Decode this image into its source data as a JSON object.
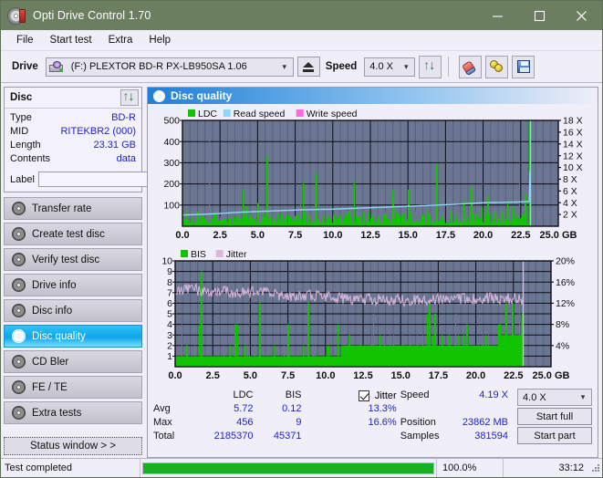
{
  "window": {
    "title": "Opti Drive Control 1.70",
    "icon": "disc-icon",
    "minimize": "minimize-icon",
    "maximize": "maximize-icon",
    "close": "close-icon"
  },
  "menubar": {
    "items": [
      {
        "label": "File",
        "accel": "F"
      },
      {
        "label": "Start test",
        "accel": "S"
      },
      {
        "label": "Extra",
        "accel": "x"
      },
      {
        "label": "Help",
        "accel": "H"
      }
    ]
  },
  "toolbar": {
    "drive_label": "Drive",
    "drive_value": "(F:)   PLEXTOR BD-R  PX-LB950SA 1.06",
    "drive_icon": "drive-icon",
    "eject_label": "eject-icon",
    "speed_label": "Speed",
    "speed_value": "4.0 X",
    "refresh_icon": "refresh-icon",
    "erase_icon": "eraser-icon",
    "key_icon": "key-icon",
    "save_icon": "floppy-save-icon"
  },
  "sidebar": {
    "disc_panel": {
      "title": "Disc",
      "refresh_icon": "refresh-icon",
      "rows": [
        {
          "key": "Type",
          "value": "BD-R"
        },
        {
          "key": "MID",
          "value": "RITEKBR2 (000)"
        },
        {
          "key": "Length",
          "value": "23.31 GB"
        },
        {
          "key": "Contents",
          "value": "data"
        }
      ],
      "label_key": "Label",
      "label_value": "",
      "label_placeholder": "",
      "label_button_icon": "cd-icon"
    },
    "nav": [
      {
        "label": "Transfer rate",
        "icon": "disc-icon",
        "active": false
      },
      {
        "label": "Create test disc",
        "icon": "disc-icon",
        "active": false
      },
      {
        "label": "Verify test disc",
        "icon": "disc-icon",
        "active": false
      },
      {
        "label": "Drive info",
        "icon": "disc-icon",
        "active": false
      },
      {
        "label": "Disc info",
        "icon": "disc-icon",
        "active": false
      },
      {
        "label": "Disc quality",
        "icon": "disc-icon",
        "active": true
      },
      {
        "label": "CD Bler",
        "icon": "disc-icon",
        "active": false
      },
      {
        "label": "FE / TE",
        "icon": "disc-icon",
        "active": false
      },
      {
        "label": "Extra tests",
        "icon": "disc-icon",
        "active": false
      }
    ],
    "status_window_button": "Status window > >"
  },
  "content": {
    "header": "Disc quality",
    "header_icon": "disc-icon"
  },
  "stats": {
    "col_headers": {
      "ldc": "LDC",
      "bis": "BIS",
      "jitter": "Jitter"
    },
    "jitter_checked": true,
    "rows": [
      {
        "key": "Avg",
        "ldc": "5.72",
        "bis": "0.12",
        "jitter": "13.3%"
      },
      {
        "key": "Max",
        "ldc": "456",
        "bis": "9",
        "jitter": "16.6%"
      },
      {
        "key": "Total",
        "ldc": "2185370",
        "bis": "45371",
        "jitter": ""
      }
    ],
    "right": [
      {
        "key": "Speed",
        "value": "4.19 X"
      },
      {
        "key": "Position",
        "value": "23862 MB"
      },
      {
        "key": "Samples",
        "value": "381594"
      }
    ],
    "speed_select": "4.0 X",
    "start_full": "Start full",
    "start_part": "Start part"
  },
  "statusbar": {
    "text": "Test completed",
    "progress_percent": 100.0,
    "percent_label": "100.0%",
    "elapsed": "33:12"
  },
  "colors": {
    "titlebar": "#6b7f60",
    "accent_blue": "#1f7fd8",
    "chart_bg": "#6b7693",
    "ldc_green": "#12c400",
    "read_speed": "#8fd8f5",
    "write_speed": "#ff66dd",
    "jitter_pink": "#d9b6da",
    "value_text": "#2222cc",
    "progress_green": "#16b020"
  },
  "chart_data": [
    {
      "type": "line",
      "title": "Disc quality - LDC",
      "xlabel": "GB",
      "ylabel": "LDC",
      "xlim": [
        0,
        25
      ],
      "ylim": [
        0,
        500
      ],
      "y2lim": [
        0,
        18
      ],
      "y2label": "X",
      "grid": true,
      "legend_position": "top-left",
      "xticks": [
        "0.0",
        "2.5",
        "5.0",
        "7.5",
        "10.0",
        "12.5",
        "15.0",
        "17.5",
        "20.0",
        "22.5",
        "25.0 GB"
      ],
      "yticks": [
        "100",
        "200",
        "300",
        "400",
        "500"
      ],
      "y2ticks": [
        "2 X",
        "4 X",
        "6 X",
        "8 X",
        "10 X",
        "12 X",
        "14 X",
        "16 X",
        "18 X"
      ],
      "series": [
        {
          "name": "LDC",
          "color": "#12c400",
          "type": "bar",
          "note": "dense green spike field, baseline ~20-60, peaks at 1.75GB=456, 5.6GB=333, 8.9GB=250, 11.4GB=208, 16.9GB=295, 22.4GB=215, 23.1GB=500+",
          "x": [
            0.0,
            0.3,
            0.6,
            0.9,
            1.2,
            1.5,
            1.75,
            2.0,
            2.4,
            2.8,
            3.2,
            3.6,
            4.0,
            4.2,
            4.6,
            5.0,
            5.4,
            5.6,
            6.0,
            6.4,
            6.8,
            7.2,
            7.6,
            8.0,
            8.4,
            8.8,
            8.9,
            9.3,
            9.7,
            10.1,
            10.5,
            11.0,
            11.4,
            11.8,
            12.2,
            12.6,
            13.0,
            13.5,
            14.0,
            14.2,
            14.6,
            15.0,
            15.2,
            15.6,
            16.0,
            16.4,
            16.9,
            17.3,
            17.8,
            18.2,
            18.7,
            19.2,
            19.5,
            19.9,
            20.3,
            20.7,
            21.2,
            21.6,
            22.0,
            22.4,
            22.8,
            23.1
          ],
          "values": [
            60,
            35,
            42,
            30,
            55,
            38,
            456,
            45,
            28,
            35,
            40,
            50,
            170,
            95,
            35,
            110,
            60,
            333,
            48,
            32,
            40,
            45,
            55,
            205,
            52,
            165,
            250,
            48,
            40,
            60,
            45,
            70,
            208,
            50,
            42,
            55,
            48,
            60,
            170,
            75,
            55,
            172,
            62,
            48,
            52,
            60,
            295,
            55,
            70,
            48,
            120,
            185,
            60,
            95,
            140,
            65,
            70,
            118,
            95,
            215,
            150,
            500
          ]
        },
        {
          "name": "Read speed",
          "color": "#8fd8f5",
          "type": "line",
          "note": "CAV read speed ramp on right axis, ~1.9X at 0GB rising to ~4.2X at 23GB then vertical to 18X",
          "x": [
            0.0,
            2.0,
            4.0,
            6.0,
            8.0,
            10.0,
            12.0,
            14.0,
            16.0,
            18.0,
            20.0,
            22.0,
            23.1,
            23.15
          ],
          "values": [
            1.9,
            2.1,
            2.4,
            2.6,
            2.8,
            2.9,
            3.1,
            3.3,
            3.5,
            3.7,
            4.0,
            4.1,
            4.2,
            18.0
          ]
        },
        {
          "name": "Write speed",
          "color": "#ff66dd",
          "type": "line",
          "x": [],
          "values": []
        }
      ]
    },
    {
      "type": "line",
      "title": "Disc quality - BIS / Jitter",
      "xlabel": "GB",
      "ylabel": "BIS",
      "xlim": [
        0,
        25
      ],
      "ylim": [
        0,
        10
      ],
      "y2lim": [
        0,
        20
      ],
      "y2label": "%",
      "grid": true,
      "legend_position": "top-left",
      "xticks": [
        "0.0",
        "2.5",
        "5.0",
        "7.5",
        "10.0",
        "12.5",
        "15.0",
        "17.5",
        "20.0",
        "22.5",
        "25.0 GB"
      ],
      "yticks": [
        "1",
        "2",
        "3",
        "4",
        "5",
        "6",
        "7",
        "8",
        "9",
        "10"
      ],
      "y2ticks": [
        "4%",
        "8%",
        "12%",
        "16%",
        "20%"
      ],
      "series": [
        {
          "name": "BIS",
          "color": "#12c400",
          "type": "bar",
          "note": "solid green field, baseline ~1 rising to ~2-3 after 11GB, spikes to 9 at 1.75GB, 6 at 5.6GB and 8.8GB, 5-6 at 16.9GB and 22.4GB, 5 at 23.1GB",
          "x": [
            0.0,
            0.5,
            1.0,
            1.5,
            1.75,
            2.0,
            2.5,
            3.0,
            3.5,
            4.0,
            4.2,
            4.5,
            5.0,
            5.6,
            6.0,
            6.5,
            7.0,
            7.5,
            7.6,
            8.0,
            8.5,
            8.8,
            9.0,
            9.5,
            10.0,
            10.5,
            11.0,
            11.5,
            12.0,
            12.5,
            13.0,
            13.5,
            14.0,
            14.5,
            15.0,
            15.5,
            16.0,
            16.5,
            16.9,
            17.5,
            18.0,
            18.5,
            19.0,
            19.4,
            20.0,
            20.5,
            21.0,
            21.5,
            22.0,
            22.4,
            22.8,
            23.1
          ],
          "values": [
            3,
            2,
            2,
            2,
            9,
            2,
            2,
            2,
            2,
            4,
            3,
            2,
            3,
            6,
            2,
            2,
            2,
            4,
            3,
            2,
            3,
            6,
            2,
            2,
            2,
            2,
            2,
            2,
            3,
            3,
            3,
            3,
            3,
            3,
            3,
            3,
            3,
            3,
            6,
            3,
            3,
            3,
            3,
            4,
            3,
            3,
            3,
            4,
            6,
            6,
            3,
            5
          ]
        },
        {
          "name": "Jitter",
          "color": "#d9b6da",
          "type": "line",
          "note": "noisy band, ~13-16% early (7-8 on left scale) drifting down to ~12-13% (6-7) after 12GB",
          "x": [
            0.0,
            1.0,
            2.0,
            3.0,
            4.0,
            5.0,
            6.0,
            7.0,
            8.0,
            9.0,
            10.0,
            11.0,
            12.0,
            13.0,
            14.0,
            15.0,
            16.0,
            17.0,
            18.0,
            19.0,
            20.0,
            21.0,
            22.0,
            23.0
          ],
          "values": [
            14.2,
            14.6,
            14.4,
            14.2,
            14.0,
            14.2,
            14.0,
            13.6,
            13.4,
            13.4,
            13.2,
            13.0,
            12.8,
            12.8,
            12.6,
            12.6,
            12.6,
            12.8,
            12.8,
            12.8,
            12.8,
            13.0,
            13.0,
            12.8
          ]
        }
      ]
    }
  ]
}
